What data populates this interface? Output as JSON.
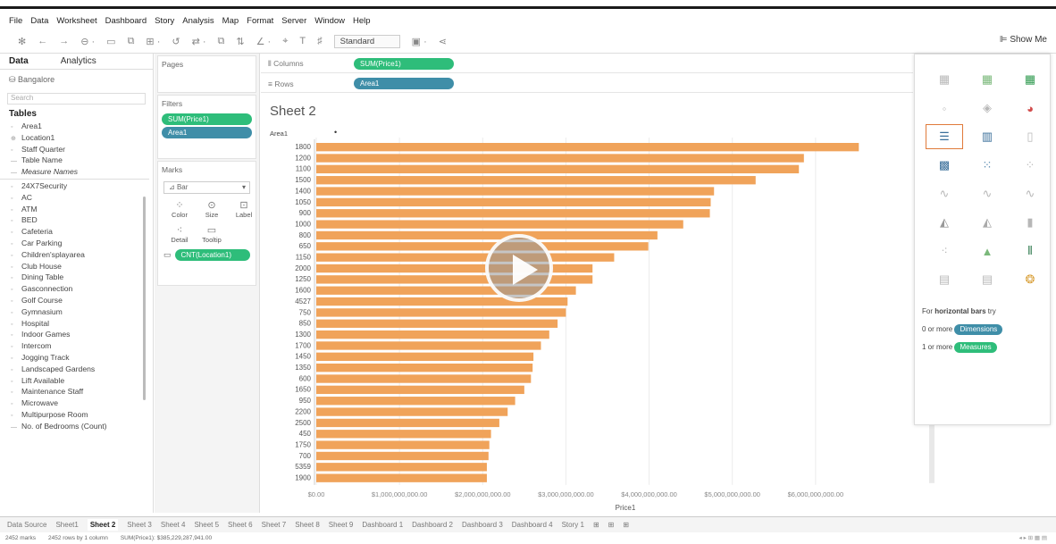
{
  "menu": [
    "File",
    "Data",
    "Worksheet",
    "Dashboard",
    "Story",
    "Analysis",
    "Map",
    "Format",
    "Server",
    "Window",
    "Help"
  ],
  "toolbar": {
    "fit": "Standard",
    "show_me": "Show Me"
  },
  "datapane": {
    "tabs": [
      "Data",
      "Analytics"
    ],
    "source": "Bangalore",
    "search_placeholder": "Search",
    "tables_label": "Tables",
    "dimensions": [
      "Area1",
      "Location1",
      "Staff Quarter",
      "Table Name",
      "Measure Names"
    ],
    "fields": [
      "24X7Security",
      "AC",
      "ATM",
      "BED",
      "Cafeteria",
      "Car Parking",
      "Children'splayarea",
      "Club House",
      "Dining Table",
      "Gasconnection",
      "Golf Course",
      "Gymnasium",
      "Hospital",
      "Indoor Games",
      "Intercom",
      "Jogging Track",
      "Landscaped Gardens",
      "Lift Available",
      "Maintenance Staff",
      "Microwave",
      "Multipurpose Room",
      "No. of Bedrooms (Count)"
    ]
  },
  "shelves": {
    "pages_label": "Pages",
    "filters_label": "Filters",
    "filters": [
      "SUM(Price1)",
      "Area1"
    ],
    "marks_label": "Marks",
    "mark_type": "Bar",
    "mark_buttons": [
      "Color",
      "Size",
      "Label",
      "Detail",
      "Tooltip"
    ],
    "mark_pill": "CNT(Location1)",
    "columns_label": "Columns",
    "columns_pill": "SUM(Price1)",
    "rows_label": "Rows",
    "rows_pill": "Area1"
  },
  "sheet_title": "Sheet 2",
  "chart_data": {
    "type": "bar",
    "orientation": "horizontal",
    "row_header": "Area1",
    "xlabel": "Price1",
    "color": "#f0a35a",
    "categories": [
      "1800",
      "1200",
      "1100",
      "1500",
      "1400",
      "1050",
      "900",
      "1000",
      "800",
      "650",
      "1150",
      "2000",
      "1250",
      "1600",
      "4527",
      "750",
      "850",
      "1300",
      "1700",
      "1450",
      "1350",
      "600",
      "1650",
      "950",
      "2200",
      "2500",
      "450",
      "1750",
      "700",
      "5359",
      "1900"
    ],
    "values": [
      6520000000,
      5860000000,
      5800000000,
      5280000000,
      4780000000,
      4740000000,
      4730000000,
      4410000000,
      4100000000,
      3990000000,
      3580000000,
      3320000000,
      3320000000,
      3120000000,
      3020000000,
      3000000000,
      2900000000,
      2800000000,
      2700000000,
      2610000000,
      2600000000,
      2580000000,
      2500000000,
      2390000000,
      2300000000,
      2200000000,
      2100000000,
      2080000000,
      2070000000,
      2050000000,
      2050000000
    ],
    "xticks": [
      "$0.00",
      "$1,000,000,000.00",
      "$2,000,000,000.00",
      "$3,000,000,000.00",
      "$4,000,000,000.00",
      "$5,000,000,000.00",
      "$6,000,000,000.00"
    ],
    "xlim": [
      0,
      7000000000
    ],
    "grid": true
  },
  "showme": {
    "hint_pre": "For ",
    "hint_bold": "horizontal bars",
    "hint_post": " try",
    "dim_pre": "0 or more",
    "dim_pill": "Dimensions",
    "meas_pre": "1 or more",
    "meas_pill": "Measures"
  },
  "tabs": [
    "Data Source",
    "Sheet1",
    "Sheet 2",
    "Sheet 3",
    "Sheet 4",
    "Sheet 5",
    "Sheet 6",
    "Sheet 7",
    "Sheet 8",
    "Sheet 9",
    "Dashboard 1",
    "Dashboard 2",
    "Dashboard 3",
    "Dashboard 4",
    "Story 1"
  ],
  "active_tab": "Sheet 2",
  "status": [
    "2452 marks",
    "2452 rows by 1 column",
    "SUM(Price1): $385,229,287,941.00"
  ]
}
